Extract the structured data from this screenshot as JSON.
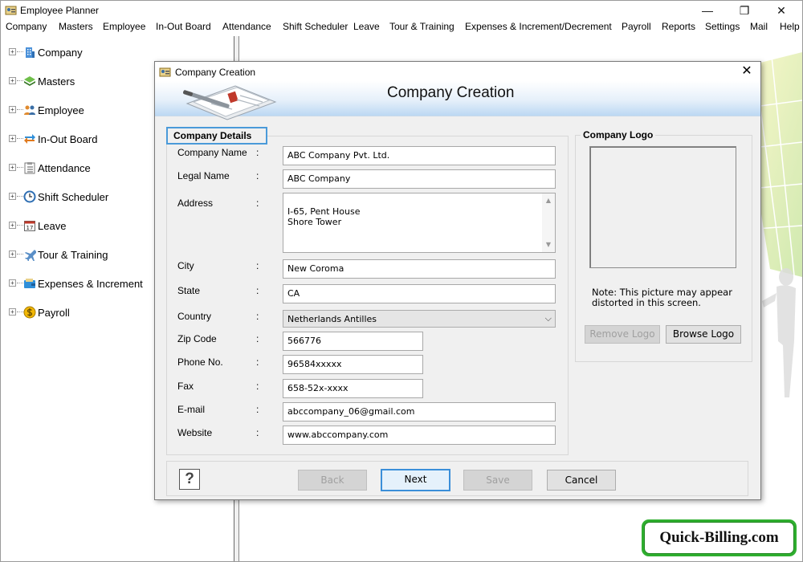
{
  "window": {
    "title": "Employee Planner",
    "minimize_glyph": "—",
    "maximize_glyph": "❐",
    "close_glyph": "✕"
  },
  "menu": [
    {
      "label": "Company"
    },
    {
      "label": "Masters"
    },
    {
      "label": "Employee"
    },
    {
      "label": "In-Out Board"
    },
    {
      "label": "Attendance"
    },
    {
      "label": "Shift Scheduler"
    },
    {
      "label": "Leave"
    },
    {
      "label": "Tour & Training"
    },
    {
      "label": "Expenses & Increment/Decrement"
    },
    {
      "label": "Payroll"
    },
    {
      "label": "Reports"
    },
    {
      "label": "Settings"
    },
    {
      "label": "Mail"
    },
    {
      "label": "Help"
    }
  ],
  "tree": [
    {
      "label": "Company",
      "icon": "building-icon"
    },
    {
      "label": "Masters",
      "icon": "layers-icon"
    },
    {
      "label": "Employee",
      "icon": "people-icon"
    },
    {
      "label": "In-Out Board",
      "icon": "swap-arrows-icon"
    },
    {
      "label": "Attendance",
      "icon": "checklist-icon"
    },
    {
      "label": "Shift Scheduler",
      "icon": "clock-icon"
    },
    {
      "label": "Leave",
      "icon": "calendar-icon"
    },
    {
      "label": "Tour & Training",
      "icon": "airplane-icon"
    },
    {
      "label": "Expenses & Increment",
      "icon": "wallet-icon"
    },
    {
      "label": "Payroll",
      "icon": "coin-icon"
    }
  ],
  "tree_expand_glyph": "+",
  "calendar_day": "17",
  "dialog": {
    "title": "Company Creation",
    "heading": "Company Creation",
    "close_glyph": "✕",
    "details_group": "Company Details",
    "logo_group": "Company Logo",
    "colon": ":",
    "fields": {
      "company_name": {
        "label": "Company Name",
        "value": "ABC Company Pvt. Ltd."
      },
      "legal_name": {
        "label": "Legal Name",
        "value": "ABC Company"
      },
      "address": {
        "label": "Address",
        "value": "I-65, Pent House\nShore Tower"
      },
      "city": {
        "label": "City",
        "value": "New Coroma"
      },
      "state": {
        "label": "State",
        "value": "CA"
      },
      "country": {
        "label": "Country",
        "value": "Netherlands Antilles"
      },
      "zip": {
        "label": "Zip Code",
        "value": "566776"
      },
      "phone": {
        "label": "Phone No.",
        "value": "96584xxxxx"
      },
      "fax": {
        "label": "Fax",
        "value": "658-52x-xxxx"
      },
      "email": {
        "label": "E-mail",
        "value": "abccompany_06@gmail.com"
      },
      "website": {
        "label": "Website",
        "value": "www.abccompany.com"
      }
    },
    "logo_note": "Note: This picture may appear distorted in this screen.",
    "buttons": {
      "remove_logo": "Remove Logo",
      "browse_logo": "Browse Logo",
      "back": "Back",
      "next": "Next",
      "save": "Save",
      "cancel": "Cancel",
      "help": "?"
    },
    "scroll_up_glyph": "▲",
    "scroll_down_glyph": "▼",
    "dropdown_glyph": "⌵"
  },
  "badge": {
    "text": "Quick-Billing.com"
  },
  "colors": {
    "accent_focus": "#3b8fd9",
    "badge_green": "#2fae2f",
    "banner_blue": "#bcd8f3"
  }
}
